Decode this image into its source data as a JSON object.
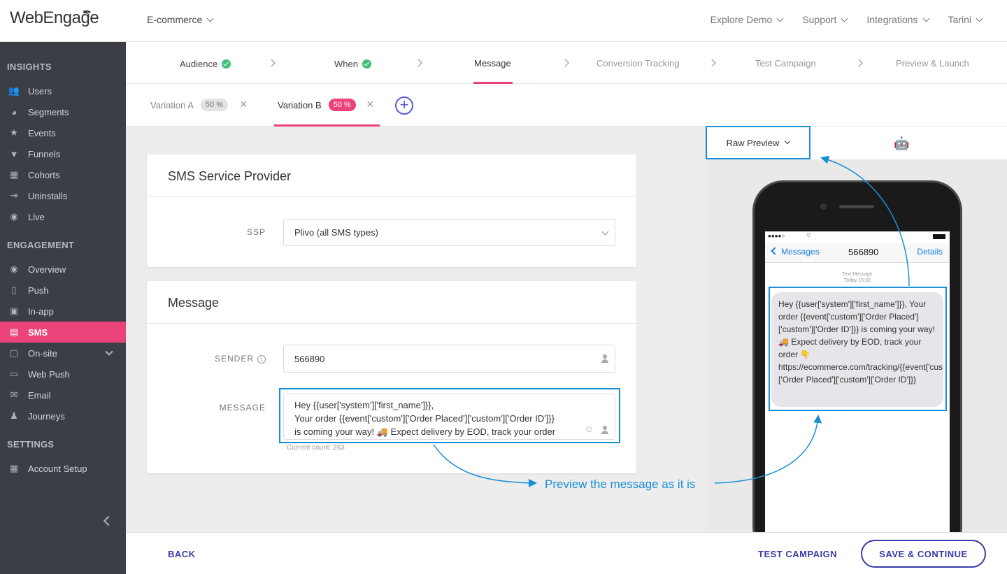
{
  "brand": {
    "logo_text": "WebEngage",
    "accent": "#e9437a",
    "primary": "#3a3aa8",
    "annotation_color": "#1a8fd6"
  },
  "topbar": {
    "project": "E-commerce",
    "nav": [
      "Explore Demo",
      "Support",
      "Integrations",
      "Tarini"
    ]
  },
  "sidebar": {
    "insights_heading": "INSIGHTS",
    "engagement_heading": "ENGAGEMENT",
    "settings_heading": "SETTINGS",
    "insights": [
      {
        "label": "Users",
        "icon": "users-icon"
      },
      {
        "label": "Segments",
        "icon": "pie-icon"
      },
      {
        "label": "Events",
        "icon": "star-icon"
      },
      {
        "label": "Funnels",
        "icon": "funnel-icon"
      },
      {
        "label": "Cohorts",
        "icon": "grid-icon"
      },
      {
        "label": "Uninstalls",
        "icon": "exit-icon"
      },
      {
        "label": "Live",
        "icon": "broadcast-icon"
      }
    ],
    "engagement": [
      {
        "label": "Overview",
        "icon": "eye-icon"
      },
      {
        "label": "Push",
        "icon": "phone-icon"
      },
      {
        "label": "In-app",
        "icon": "inapp-icon"
      },
      {
        "label": "SMS",
        "icon": "chat-icon"
      },
      {
        "label": "On-site",
        "icon": "window-icon"
      },
      {
        "label": "Web Push",
        "icon": "browser-icon"
      },
      {
        "label": "Email",
        "icon": "envelope-icon"
      },
      {
        "label": "Journeys",
        "icon": "journey-icon"
      }
    ],
    "settings": [
      {
        "label": "Account Setup",
        "icon": "dashboard-icon"
      }
    ]
  },
  "steps": [
    "Audience",
    "When",
    "Message",
    "Conversion Tracking",
    "Test Campaign",
    "Preview & Launch"
  ],
  "variations": [
    {
      "label": "Variation A",
      "percent": "50 %"
    },
    {
      "label": "Variation B",
      "percent": "50 %"
    }
  ],
  "ssp_card": {
    "title": "SMS Service Provider",
    "label": "SSP",
    "value": "Plivo (all SMS types)"
  },
  "message_card": {
    "title": "Message",
    "sender_label": "SENDER",
    "sender_value": "566890",
    "message_label": "MESSAGE",
    "message_text": "Hey {{user['system']['first_name']}},\nYour order {{event['custom']['Order Placed']['custom']['Order ID']}}\nis coming your way! 🚚 Expect delivery by EOD, track your order",
    "count": "Current count: 263"
  },
  "preview": {
    "mode": "Raw Preview",
    "back_label": "Messages",
    "number": "566890",
    "details": "Details",
    "ts_line1": "Text Message",
    "ts_line2": "Today 15:32",
    "bubble_text": "Hey {{user['system']['first_name']}}, Your order {{event['custom']['Order Placed']['custom']['Order ID']}} is coming your way! 🚚 Expect delivery by EOD, track your order 👇 https://ecommerce.com/tracking/{{event['custom']['Order Placed']['custom']['Order ID']}}"
  },
  "annotation": "Preview the message as it is",
  "footer": {
    "back": "BACK",
    "test": "TEST CAMPAIGN",
    "save": "SAVE & CONTINUE"
  }
}
